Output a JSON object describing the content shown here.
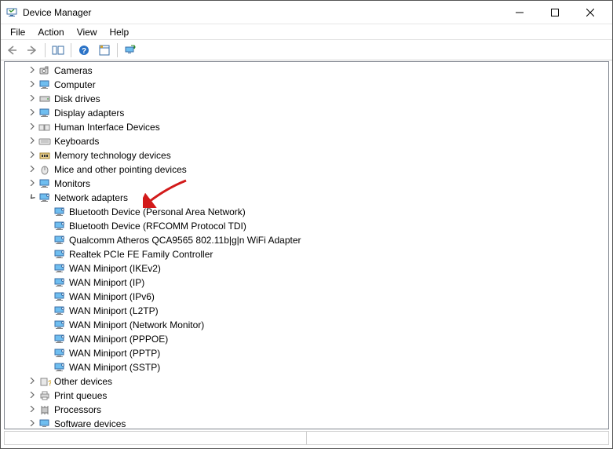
{
  "window": {
    "title": "Device Manager"
  },
  "menu": {
    "file": "File",
    "action": "Action",
    "view": "View",
    "help": "Help"
  },
  "tree": {
    "categories": {
      "cameras": "Cameras",
      "computer": "Computer",
      "disk_drives": "Disk drives",
      "display_adapters": "Display adapters",
      "hid": "Human Interface Devices",
      "keyboards": "Keyboards",
      "memory_tech": "Memory technology devices",
      "mice": "Mice and other pointing devices",
      "monitors": "Monitors",
      "network_adapters": "Network adapters",
      "other_devices": "Other devices",
      "print_queues": "Print queues",
      "processors": "Processors",
      "software_devices": "Software devices"
    },
    "network_children": [
      "Bluetooth Device (Personal Area Network)",
      "Bluetooth Device (RFCOMM Protocol TDI)",
      "Qualcomm Atheros QCA9565 802.11b|g|n WiFi Adapter",
      "Realtek PCIe FE Family Controller",
      "WAN Miniport (IKEv2)",
      "WAN Miniport (IP)",
      "WAN Miniport (IPv6)",
      "WAN Miniport (L2TP)",
      "WAN Miniport (Network Monitor)",
      "WAN Miniport (PPPOE)",
      "WAN Miniport (PPTP)",
      "WAN Miniport (SSTP)"
    ]
  }
}
